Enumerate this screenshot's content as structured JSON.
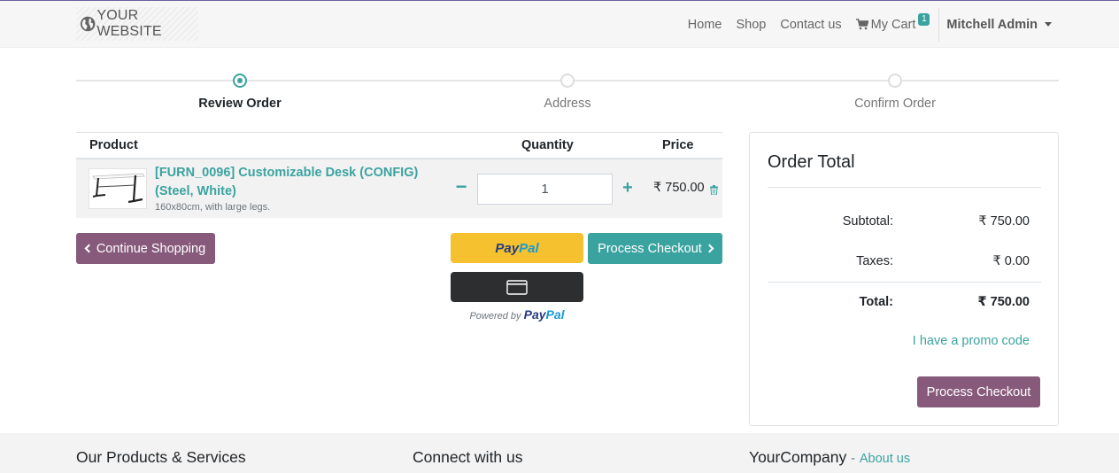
{
  "navbar": {
    "brand": "YOUR WEBSITE",
    "links": [
      "Home",
      "Shop",
      "Contact us"
    ],
    "cart_label": "My Cart",
    "cart_count": "1",
    "user": "Mitchell Admin"
  },
  "wizard": {
    "steps": [
      "Review Order",
      "Address",
      "Confirm Order"
    ],
    "active_step": 0
  },
  "cart": {
    "headers": {
      "product": "Product",
      "quantity": "Quantity",
      "price": "Price"
    },
    "items": [
      {
        "name": "[FURN_0096] Customizable Desk (CONFIG) (Steel, White)",
        "description": "160x80cm, with large legs.",
        "quantity": "1",
        "price": "₹ 750.00"
      }
    ]
  },
  "actions": {
    "continue_label": "Continue Shopping",
    "checkout_label": "Process Checkout",
    "paypal_pay": "Pay",
    "paypal_pal": "Pal",
    "powered_by": "Powered by"
  },
  "order_total": {
    "title": "Order Total",
    "subtotal_label": "Subtotal:",
    "subtotal_value": "₹ 750.00",
    "taxes_label": "Taxes:",
    "taxes_value": "₹ 0.00",
    "total_label": "Total:",
    "total_value": "₹ 750.00",
    "promo_label": "I have a promo code",
    "checkout_label": "Process Checkout"
  },
  "footer": {
    "col1": "Our Products & Services",
    "col2": "Connect with us",
    "col3_company": "YourCompany",
    "col3_sep": "-",
    "col3_link": "About us"
  },
  "colors": {
    "primary": "#875a7b",
    "accent": "#3aa3a0",
    "paypal_yellow": "#f5c12e",
    "paypal_dark": "#2c2e2f"
  }
}
